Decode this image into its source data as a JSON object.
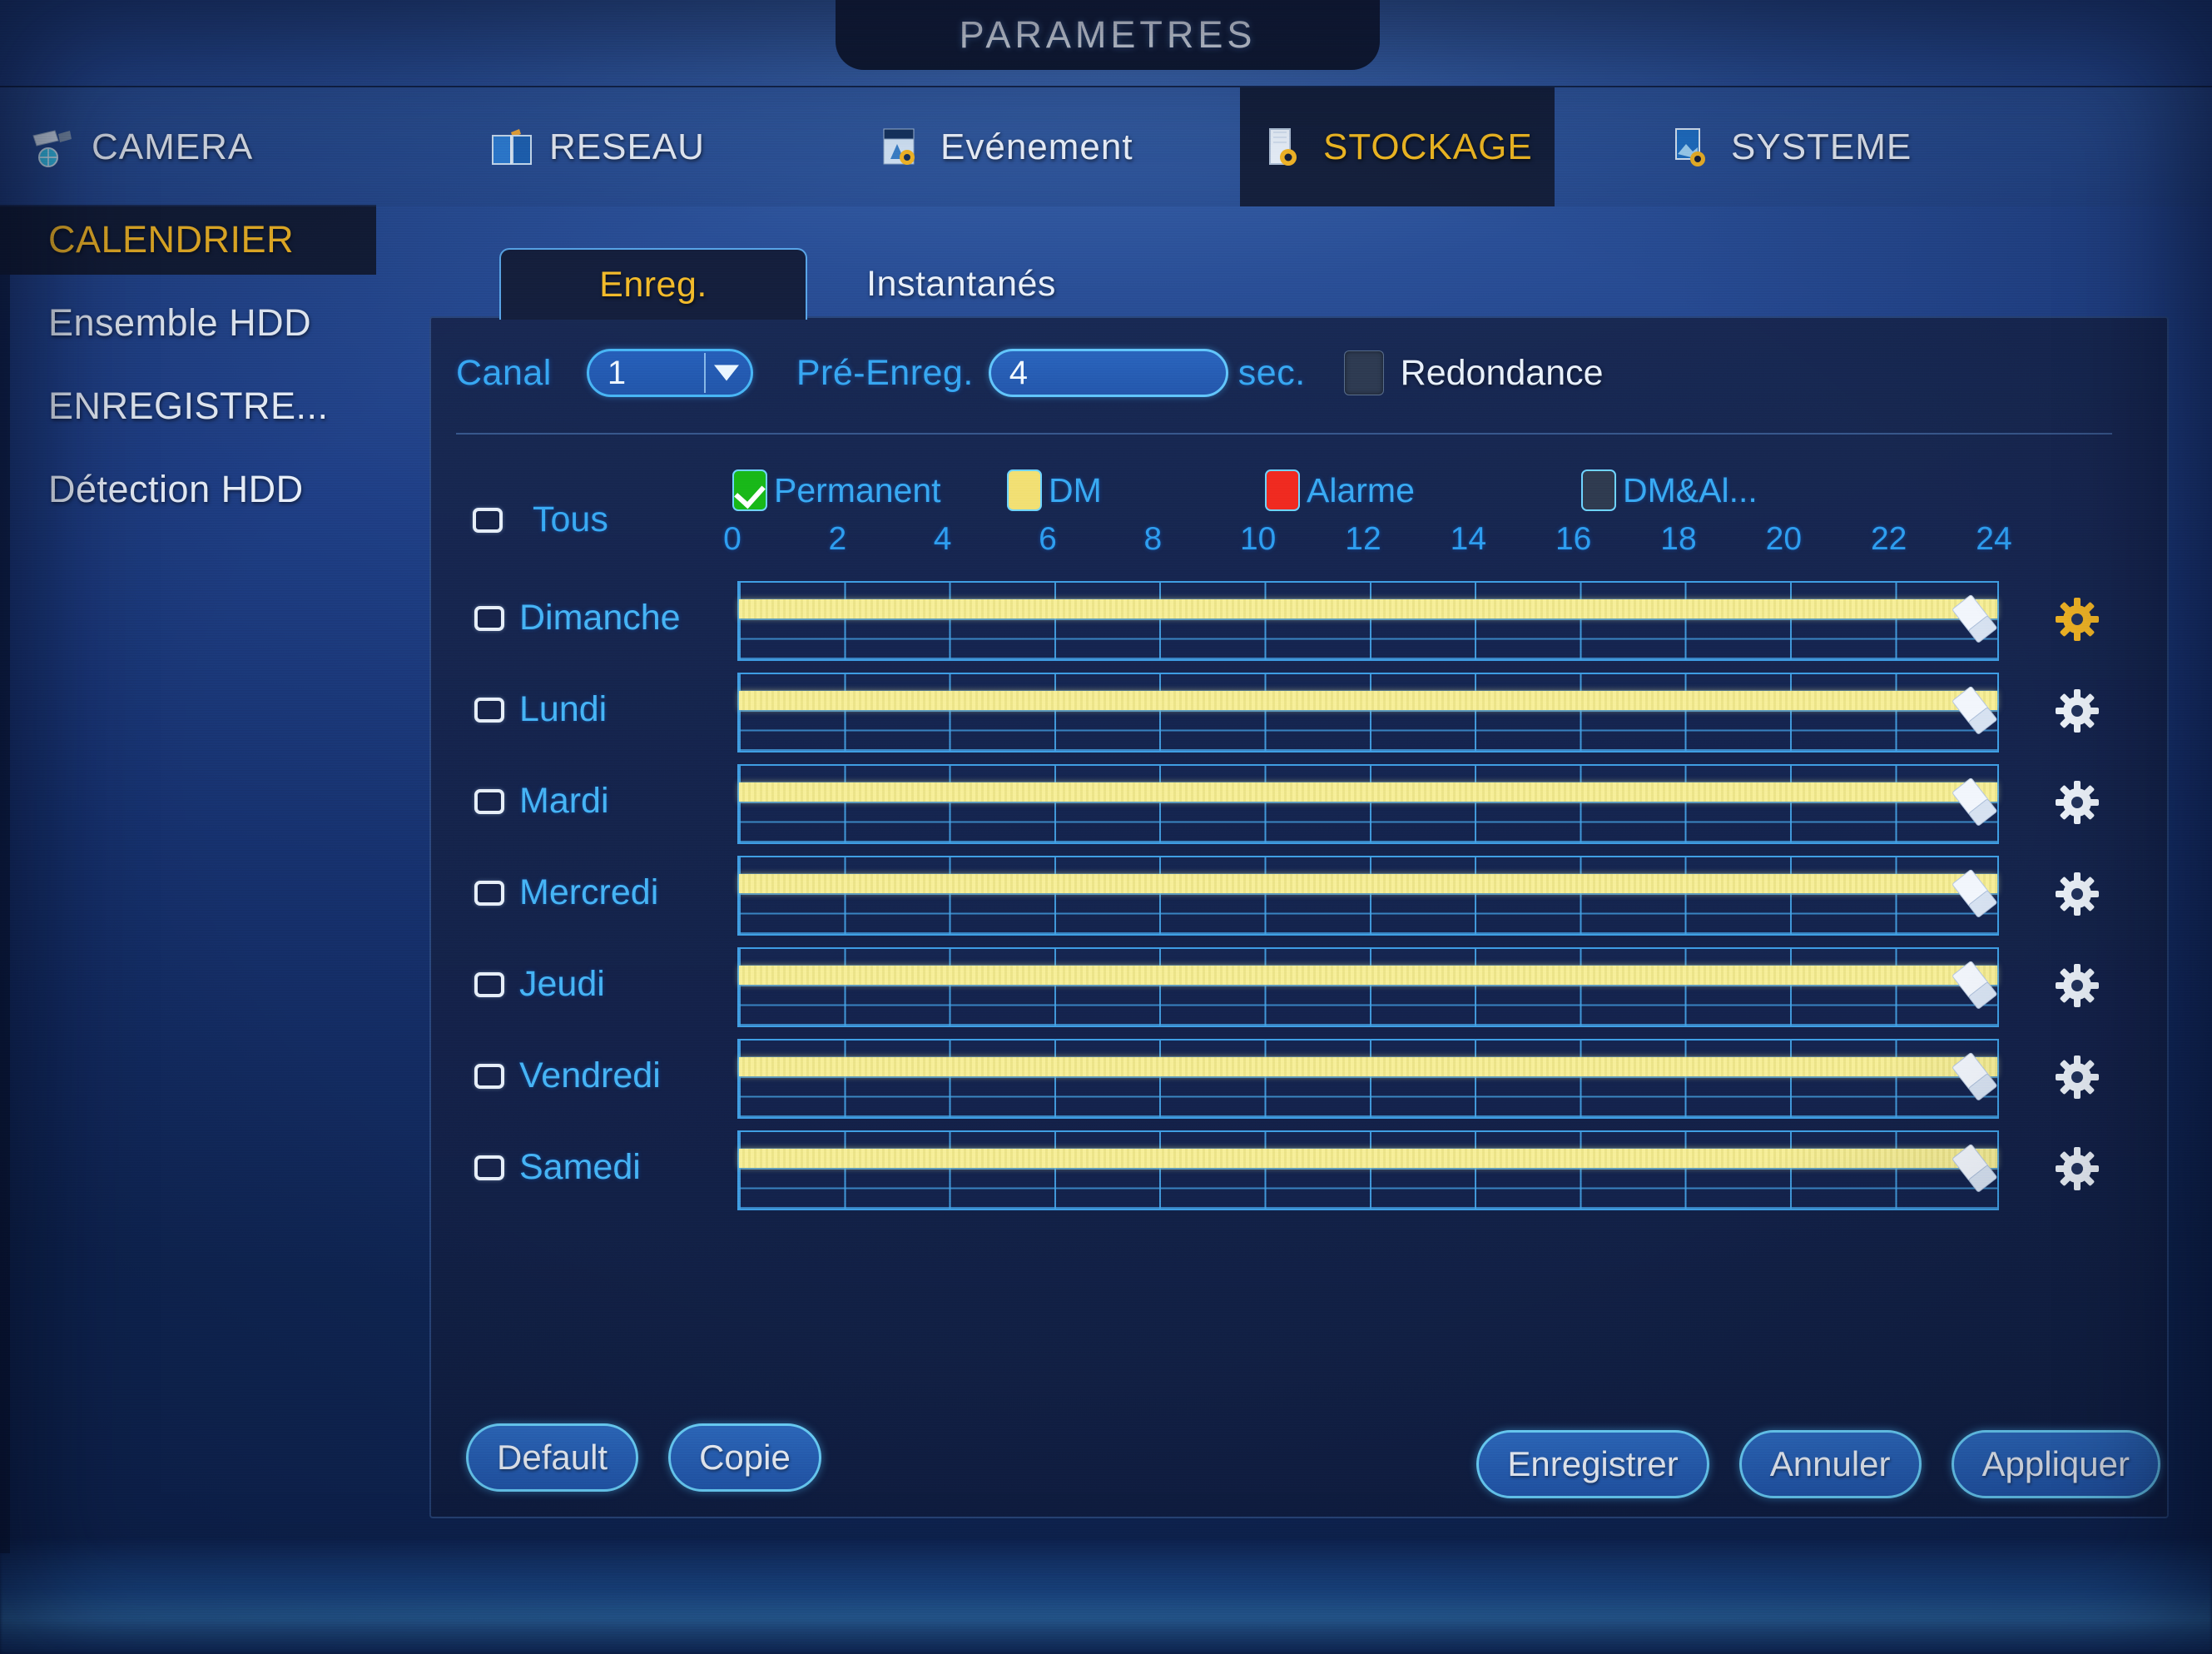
{
  "window": {
    "title": "PARAMETRES"
  },
  "menubar": {
    "items": [
      {
        "label": "CAMERA",
        "icon": "camera-icon",
        "active": false
      },
      {
        "label": "RESEAU",
        "icon": "network-icon",
        "active": false
      },
      {
        "label": "Evénement",
        "icon": "event-icon",
        "active": false
      },
      {
        "label": "STOCKAGE",
        "icon": "storage-icon",
        "active": true
      },
      {
        "label": "SYSTEME",
        "icon": "system-icon",
        "active": false
      }
    ]
  },
  "sidebar": {
    "items": [
      {
        "label": "CALENDRIER",
        "active": true
      },
      {
        "label": "Ensemble HDD",
        "active": false
      },
      {
        "label": "ENREGISTRE...",
        "active": false
      },
      {
        "label": "Détection HDD",
        "active": false
      }
    ]
  },
  "tabs": [
    {
      "label": "Enreg.",
      "active": true
    },
    {
      "label": "Instantanés",
      "active": false
    }
  ],
  "controls": {
    "channel_label": "Canal",
    "channel_value": "1",
    "prerecord_label": "Pré-Enreg.",
    "prerecord_value": "4",
    "seconds_label": "sec.",
    "redundancy_label": "Redondance",
    "redundancy_checked": false
  },
  "legend": [
    {
      "label": "Permanent",
      "color": "#18b818",
      "checked": true,
      "swatch": "green"
    },
    {
      "label": "DM",
      "color": "#f2e074",
      "checked": false,
      "swatch": "yellow"
    },
    {
      "label": "Alarme",
      "color": "#f02a20",
      "checked": false,
      "swatch": "red"
    },
    {
      "label": "DM&Al...",
      "color": "#2f3b50",
      "checked": false,
      "swatch": "dark"
    }
  ],
  "schedule": {
    "all_label": "Tous",
    "all_checked": false,
    "axis_ticks": [
      "0",
      "2",
      "4",
      "6",
      "8",
      "10",
      "12",
      "14",
      "16",
      "18",
      "20",
      "22",
      "24"
    ],
    "axis_min": 0,
    "axis_max": 24,
    "days": [
      {
        "label": "Dimanche",
        "checked": false,
        "period_start": 0,
        "period_end": 24,
        "period_type": "Permanent",
        "gear_active": true
      },
      {
        "label": "Lundi",
        "checked": false,
        "period_start": 0,
        "period_end": 24,
        "period_type": "Permanent",
        "gear_active": false
      },
      {
        "label": "Mardi",
        "checked": false,
        "period_start": 0,
        "period_end": 24,
        "period_type": "Permanent",
        "gear_active": false
      },
      {
        "label": "Mercredi",
        "checked": false,
        "period_start": 0,
        "period_end": 24,
        "period_type": "Permanent",
        "gear_active": false
      },
      {
        "label": "Jeudi",
        "checked": false,
        "period_start": 0,
        "period_end": 24,
        "period_type": "Permanent",
        "gear_active": false
      },
      {
        "label": "Vendredi",
        "checked": false,
        "period_start": 0,
        "period_end": 24,
        "period_type": "Permanent",
        "gear_active": false
      },
      {
        "label": "Samedi",
        "checked": false,
        "period_start": 0,
        "period_end": 24,
        "period_type": "Permanent",
        "gear_active": false
      }
    ]
  },
  "buttons": {
    "left": [
      {
        "label": "Default"
      },
      {
        "label": "Copie"
      }
    ],
    "right": [
      {
        "label": "Enregistrer"
      },
      {
        "label": "Annuler"
      },
      {
        "label": "Appliquer"
      }
    ]
  },
  "colors": {
    "accent_gold": "#f0b923",
    "cyan_text": "#39aaf3",
    "panel_bg": "#16264e",
    "bar_yellow": "#f2ea90",
    "grid_line": "#46a5e8"
  }
}
